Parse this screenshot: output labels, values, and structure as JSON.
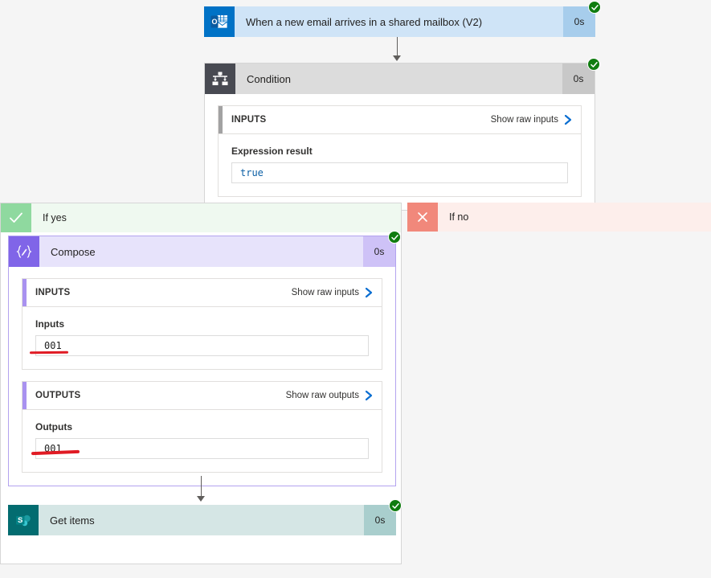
{
  "flow": {
    "trigger": {
      "title": "When a new email arrives in a shared mailbox (V2)",
      "duration": "0s",
      "icon": "outlook-icon",
      "status": "succeeded"
    },
    "condition": {
      "title": "Condition",
      "duration": "0s",
      "icon": "condition-icon",
      "status": "succeeded",
      "inputs_panel": {
        "label": "INPUTS",
        "raw_link": "Show raw inputs",
        "field_label": "Expression result",
        "value": "true"
      }
    },
    "branch_yes": {
      "label": "If yes",
      "icon": "checkmark-icon"
    },
    "branch_no": {
      "label": "If no",
      "icon": "close-x-icon"
    },
    "compose": {
      "title": "Compose",
      "duration": "0s",
      "icon": "compose-braces-icon",
      "status": "succeeded",
      "inputs_panel": {
        "label": "INPUTS",
        "raw_link": "Show raw inputs",
        "field_label": "Inputs",
        "value": "001"
      },
      "outputs_panel": {
        "label": "OUTPUTS",
        "raw_link": "Show raw outputs",
        "field_label": "Outputs",
        "value": "001"
      }
    },
    "get_items": {
      "title": "Get items",
      "duration": "0s",
      "icon": "sharepoint-icon",
      "status": "succeeded"
    }
  },
  "colors": {
    "success_green": "#107c10",
    "trigger_blue": "#0072c6",
    "condition_gray": "#484a52",
    "compose_purple": "#8065e8",
    "sharepoint_teal": "#036c70",
    "branch_yes_green": "#8fd99f",
    "branch_no_red": "#f1887b",
    "annotation_red": "#e01b24",
    "link_blue": "#0a6ed1"
  }
}
